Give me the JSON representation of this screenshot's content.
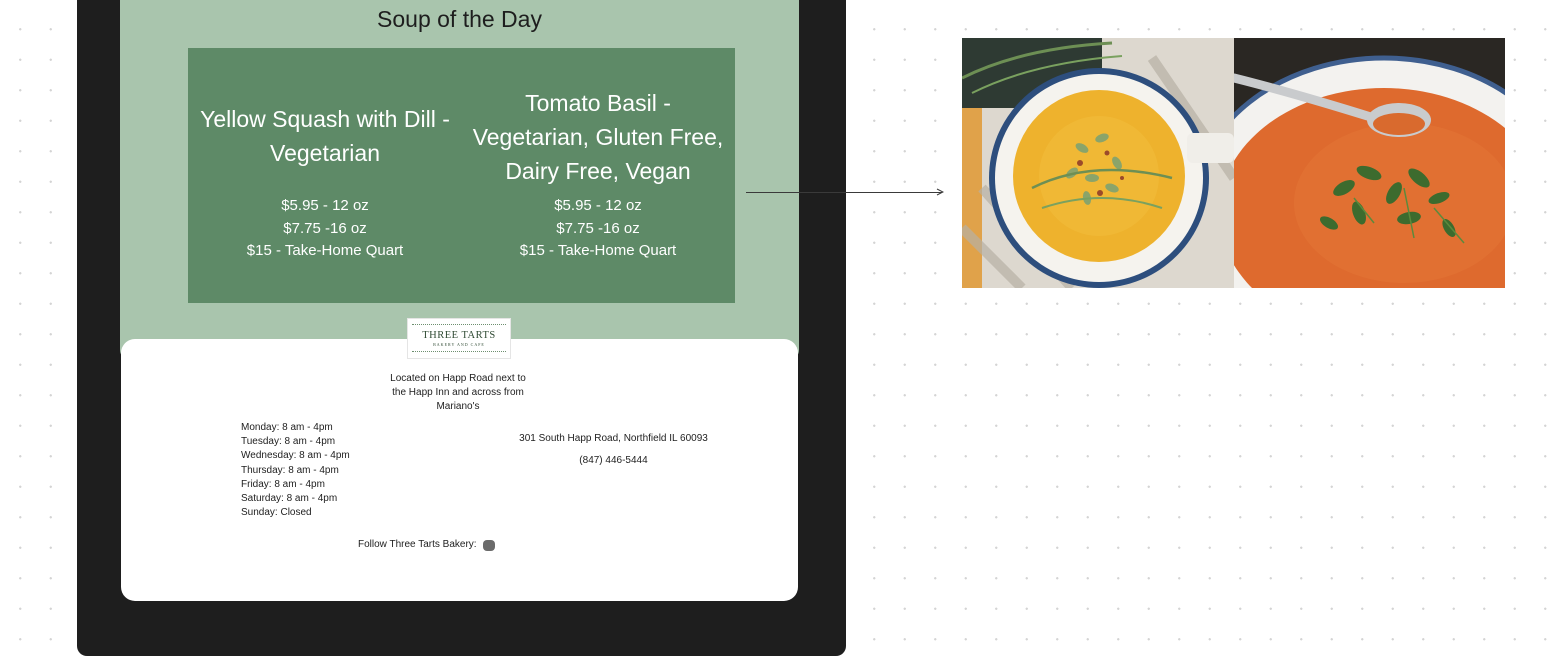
{
  "menu": {
    "title": "Soup of the Day",
    "soups": [
      {
        "name": "Yellow Squash with Dill - Vegetarian",
        "prices": [
          "$5.95 - 12 oz",
          "$7.75 -16 oz",
          "$15 - Take-Home Quart"
        ]
      },
      {
        "name": "Tomato Basil - Vegetarian, Gluten Free, Dairy Free, Vegan",
        "prices": [
          "$5.95 - 12 oz",
          "$7.75 -16 oz",
          "$15 - Take-Home Quart"
        ]
      }
    ]
  },
  "logo": {
    "main": "THREE TARTS",
    "sub": "BAKERY AND CAFE"
  },
  "info": {
    "location": "Located on Happ Road next to the Happ Inn and across from Mariano's",
    "hours": [
      "Monday: 8 am - 4pm",
      "Tuesday: 8 am - 4pm",
      "Wednesday: 8 am - 4pm",
      "Thursday: 8 am - 4pm",
      "Friday: 8 am - 4pm",
      "Saturday: 8 am - 4pm",
      "Sunday: Closed"
    ],
    "address": "301 South Happ Road, Northfield IL 60093",
    "phone": "(847) 446-5444",
    "follow": "Follow Three Tarts Bakery:"
  },
  "icons": {
    "social": "social-media-icon",
    "arrow": "arrow-right-icon"
  },
  "colors": {
    "canvas": "#ffffff",
    "device_frame": "#1e1e1e",
    "menu_background": "#a9c5ad",
    "soup_panel": "#5e8a67",
    "info_card": "#ffffff"
  }
}
